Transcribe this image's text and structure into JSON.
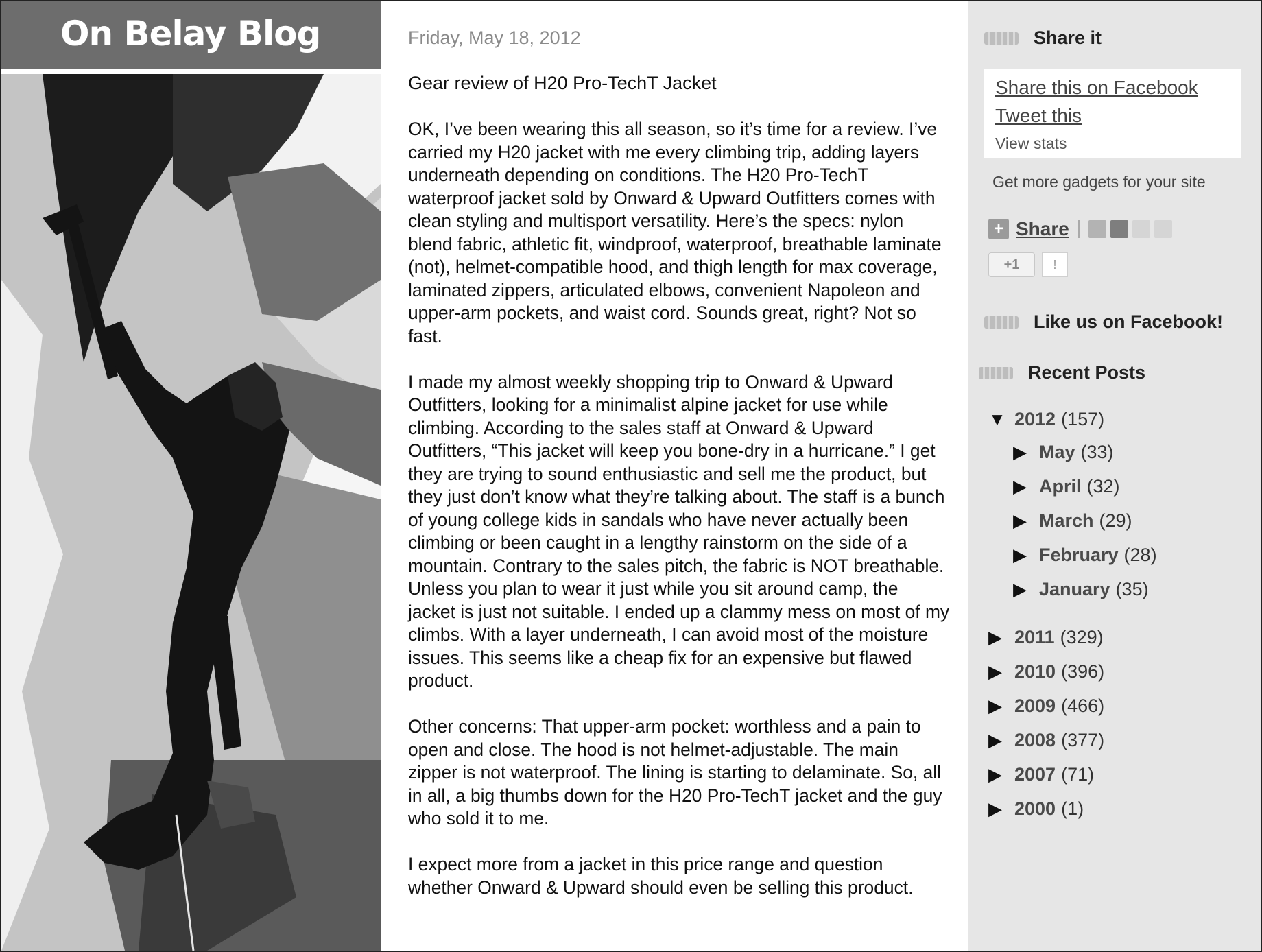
{
  "blog": {
    "title": "On Belay Blog"
  },
  "post": {
    "date": "Friday, May 18, 2012",
    "title": "Gear review of H20 Pro-TechT Jacket",
    "paragraphs": [
      "OK, I’ve been wearing this all season, so it’s time for a review. I’ve carried my H20 jacket with me every climbing trip, adding layers underneath depending on conditions. The H20 Pro-TechT waterproof jacket sold by Onward & Upward Outfitters comes with clean styling and multisport versatility. Here’s the specs: nylon blend fabric, athletic fit, windproof, waterproof, breathable laminate (not), helmet-compatible hood, and thigh length for max coverage, laminated zippers, articulated elbows, convenient Napoleon and upper-arm pockets, and waist cord. Sounds great, right? Not so fast.",
      "I made my almost weekly shopping trip to Onward & Upward Outfitters, looking for a minimalist alpine jacket for use while climbing. According to the sales staff at Onward & Upward Outfitters, “This jacket will keep you bone-dry in a hurricane.” I get they are trying to sound enthusiastic and sell me the product, but they just don’t know what they’re talking about. The staff is a bunch of young college kids in sandals who have never actually been climbing or been caught in a lengthy rainstorm on the side of a mountain. Contrary to the sales pitch, the fabric is NOT breathable. Unless you plan to wear it just while you sit around camp, the jacket is just not suitable. I ended up a clammy mess on most of my climbs. With a layer underneath, I can avoid most of the moisture issues. This seems like a cheap fix for an expensive but flawed product.",
      "Other concerns: That upper-arm pocket: worthless and a pain to open and close. The hood is not helmet-adjustable. The main zipper is not waterproof. The lining is starting to delaminate. So, all in all, a big thumbs down for the H20 Pro-TechT jacket and the guy who sold it to me.",
      "I expect more from a jacket in this price range and question whether Onward & Upward should even be selling this product."
    ]
  },
  "sidebar": {
    "share_heading": "Share it",
    "share_facebook": "Share this on Facebook",
    "tweet": "Tweet this",
    "view_stats": "View stats",
    "more_gadgets": "Get more gadgets for your site",
    "share_button": "Share",
    "plus_one": "+1",
    "like_heading": "Like us on Facebook!",
    "recent_heading": "Recent Posts",
    "archive": {
      "y2012": {
        "label": "2012",
        "count": "(157)",
        "expanded": true,
        "months": [
          {
            "label": "May",
            "count": "(33)"
          },
          {
            "label": "April",
            "count": "(32)"
          },
          {
            "label": "March",
            "count": "(29)"
          },
          {
            "label": "February",
            "count": "(28)"
          },
          {
            "label": "January",
            "count": "(35)"
          }
        ]
      },
      "years": [
        {
          "label": "2011",
          "count": "(329)"
        },
        {
          "label": "2010",
          "count": "(396)"
        },
        {
          "label": "2009",
          "count": "(466)"
        },
        {
          "label": "2008",
          "count": "(377)"
        },
        {
          "label": "2007",
          "count": "(71)"
        },
        {
          "label": "2000",
          "count": "(1)"
        }
      ]
    }
  }
}
